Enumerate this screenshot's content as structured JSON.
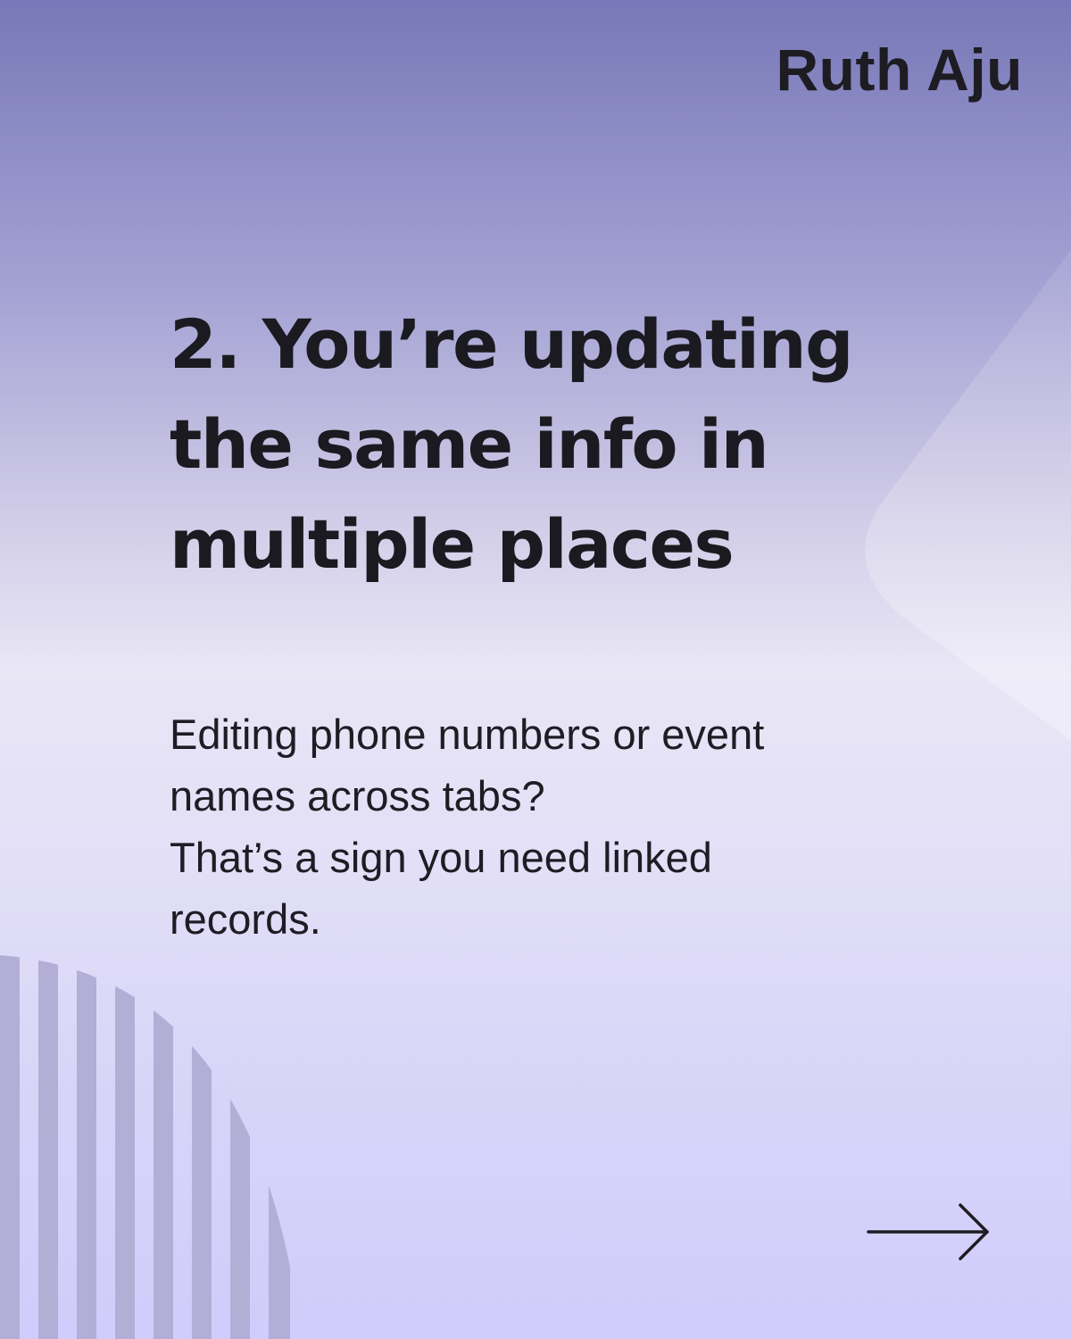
{
  "author": "Ruth Aju",
  "slide": {
    "title": "2. You’re updating the same info in multiple places",
    "body_line1": "Editing phone numbers or event names across tabs?",
    "body_line2": "That’s a sign you need linked records."
  },
  "icons": {
    "next": "arrow-right-icon"
  },
  "colors": {
    "text": "#1d1c22",
    "gradient_top": "#7878b8",
    "gradient_bottom": "#d0ccfb"
  }
}
